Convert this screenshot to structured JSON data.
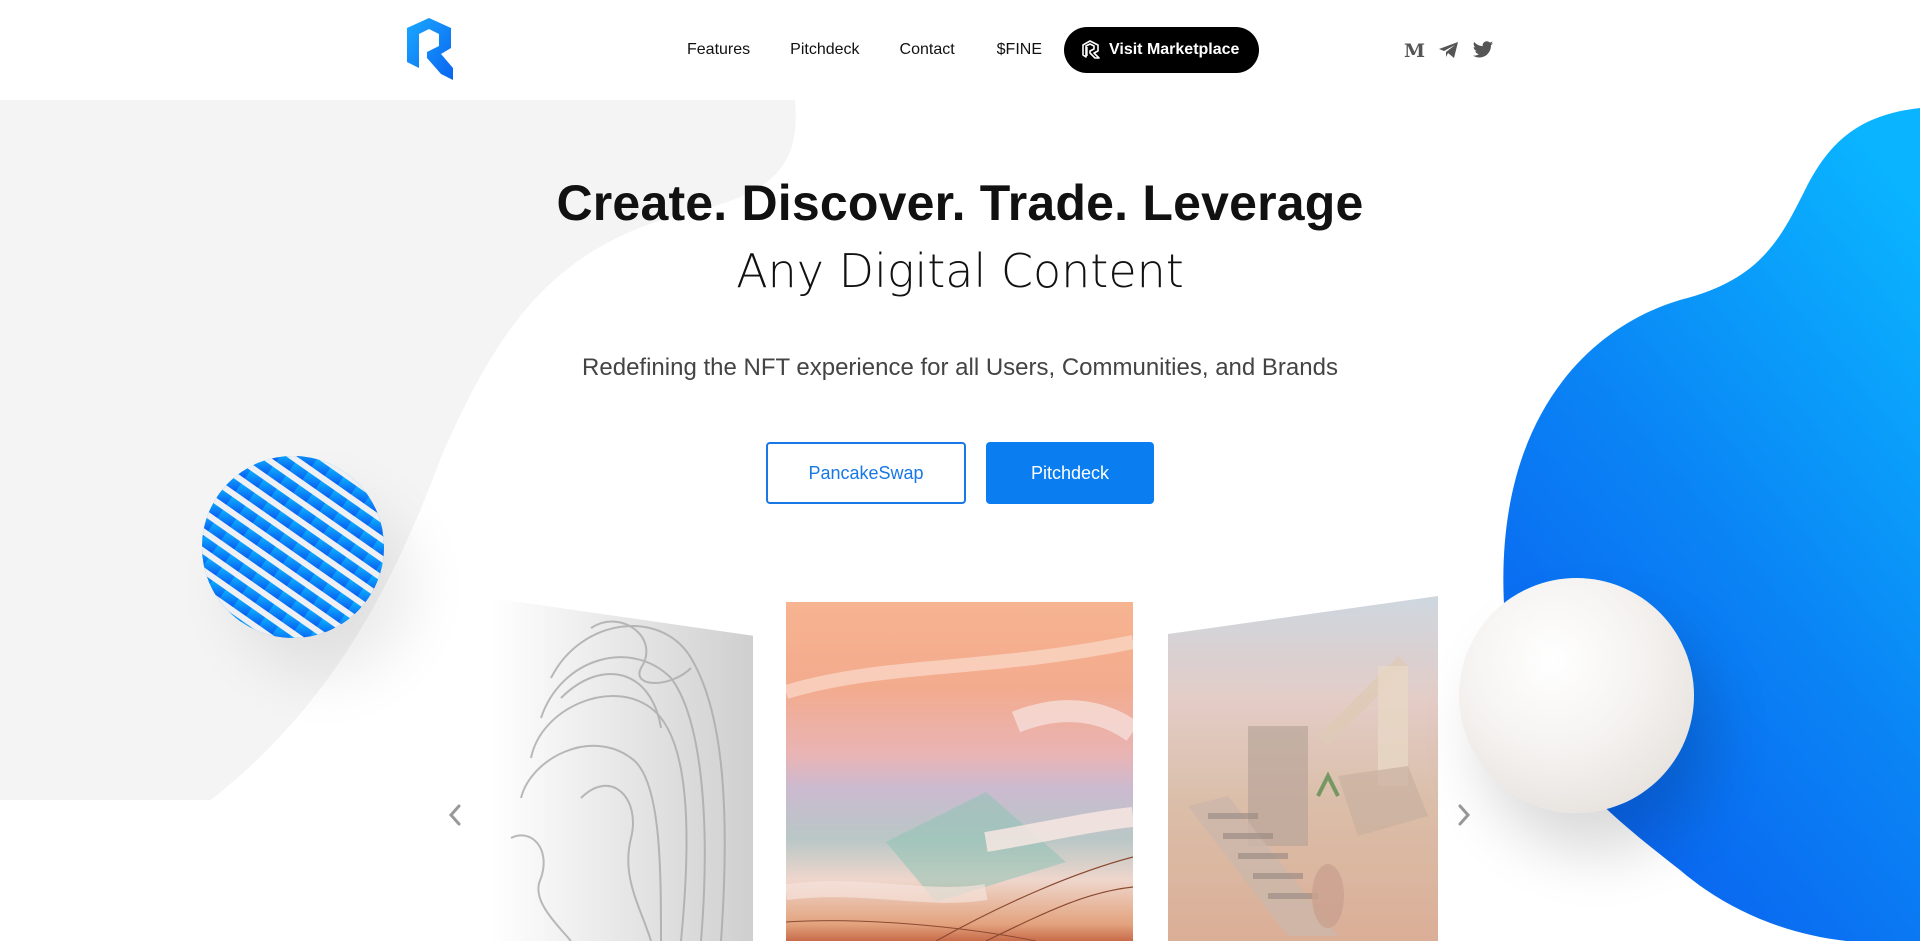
{
  "brand": {
    "logo_icon": "r-logo-icon",
    "accent_color": "#0a7df0",
    "accent_gradient": [
      "#0ab4ff",
      "#0a5cf0"
    ]
  },
  "nav": {
    "items": [
      {
        "label": "Features"
      },
      {
        "label": "Pitchdeck"
      },
      {
        "label": "Contact"
      },
      {
        "label": "$FINE"
      }
    ],
    "cta": {
      "label": "Visit Marketplace",
      "icon": "r-logo-outline-icon"
    }
  },
  "socials": [
    {
      "name": "medium",
      "icon": "medium-icon"
    },
    {
      "name": "telegram",
      "icon": "telegram-icon"
    },
    {
      "name": "twitter",
      "icon": "twitter-icon"
    }
  ],
  "hero": {
    "title_line1": "Create. Discover. Trade. Leverage",
    "title_line2": "Any Digital Content",
    "subtitle": "Redefining the NFT experience for all Users, Communities, and Brands",
    "buttons": [
      {
        "label": "PancakeSwap",
        "style": "outline"
      },
      {
        "label": "Pitchdeck",
        "style": "filled"
      }
    ]
  },
  "carousel": {
    "slides": [
      {
        "name": "sculpted-hair-face-artwork",
        "position": "left"
      },
      {
        "name": "pastel-sky-painting-artwork",
        "position": "center"
      },
      {
        "name": "surreal-staircases-artwork",
        "position": "right"
      }
    ],
    "prev_icon": "chevron-left-icon",
    "next_icon": "chevron-right-icon"
  }
}
